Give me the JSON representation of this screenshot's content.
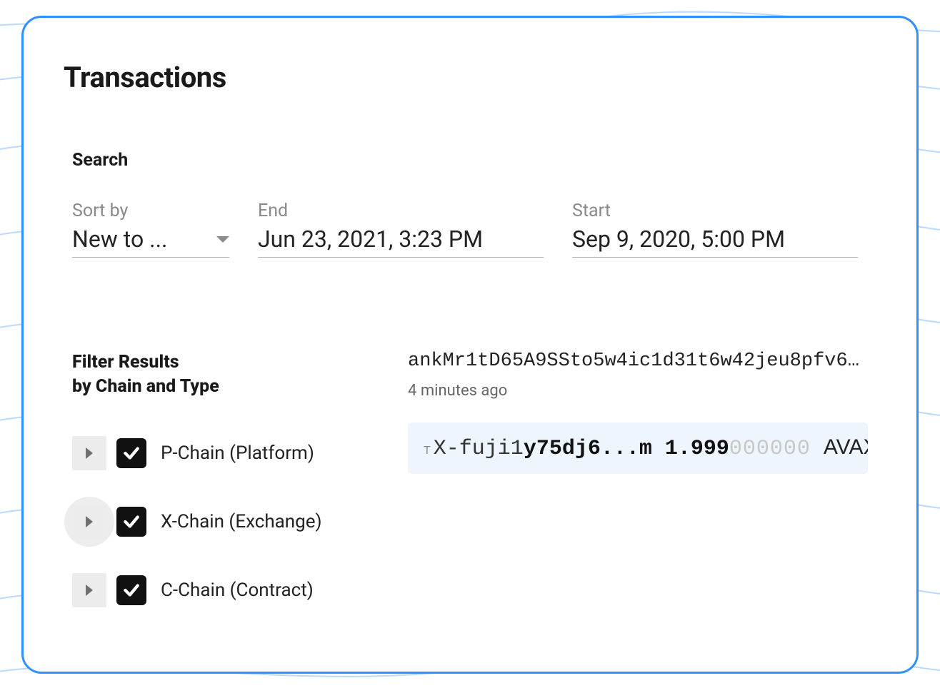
{
  "page_title": "Transactions",
  "search": {
    "label": "Search",
    "sort": {
      "label": "Sort by",
      "value": "New to ..."
    },
    "end": {
      "label": "End",
      "value": "Jun 23, 2021, 3:23 PM"
    },
    "start": {
      "label": "Start",
      "value": "Sep 9, 2020, 5:00 PM"
    }
  },
  "filter": {
    "title_line1": "Filter Results",
    "title_line2": "by Chain and Type",
    "chains": [
      {
        "label": "P-Chain (Platform)",
        "checked": true
      },
      {
        "label": "X-Chain (Exchange)",
        "checked": true
      },
      {
        "label": "C-Chain (Contract)",
        "checked": true
      }
    ]
  },
  "result": {
    "hash": "ankMr1tD65A9SSto5w4ic1d31t6w42jeu8pfv6…",
    "age": "4 minutes ago",
    "tmark": "T",
    "addr_prefix": "X-fuji1",
    "addr_bold": "y75dj6...m",
    "amount_main": "1.999",
    "amount_faded": "000000",
    "currency": "AVAX"
  }
}
